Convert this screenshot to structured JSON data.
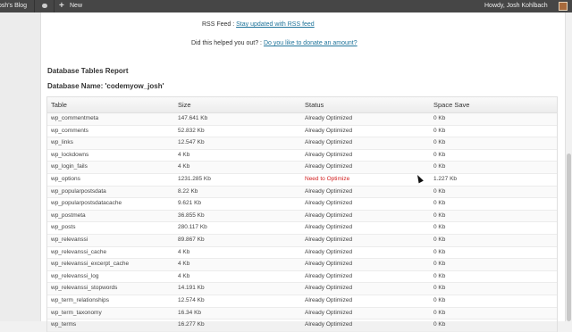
{
  "admin_bar": {
    "site_name": "osh's Blog",
    "new_label": "New",
    "greeting": "Howdy, Josh Kohlbach",
    "icons": [
      "comment-bubble-icon",
      "plus-icon",
      "avatar-icon"
    ]
  },
  "rss": {
    "label": "RSS Feed : ",
    "link": "Stay updated with RSS feed"
  },
  "donate": {
    "label": "Did this helped you out? : ",
    "link": "Do you like to donate an amount?"
  },
  "report": {
    "title": "Database Tables Report",
    "db_name": "Database Name: 'codemyow_josh'"
  },
  "table": {
    "headers": [
      "Table",
      "Size",
      "Status",
      "Space Save"
    ],
    "rows": [
      [
        "wp_commentmeta",
        "147.641 Kb",
        "Already Optimized",
        "0 Kb"
      ],
      [
        "wp_comments",
        "52.832 Kb",
        "Already Optimized",
        "0 Kb"
      ],
      [
        "wp_links",
        "12.547 Kb",
        "Already Optimized",
        "0 Kb"
      ],
      [
        "wp_lockdowns",
        "4 Kb",
        "Already Optimized",
        "0 Kb"
      ],
      [
        "wp_login_fails",
        "4 Kb",
        "Already Optimized",
        "0 Kb"
      ],
      [
        "wp_options",
        "1231.285 Kb",
        "Need to Optimize",
        "1.227 Kb"
      ],
      [
        "wp_popularpostsdata",
        "8.22 Kb",
        "Already Optimized",
        "0 Kb"
      ],
      [
        "wp_popularpostsdatacache",
        "9.621 Kb",
        "Already Optimized",
        "0 Kb"
      ],
      [
        "wp_postmeta",
        "36.855 Kb",
        "Already Optimized",
        "0 Kb"
      ],
      [
        "wp_posts",
        "280.117 Kb",
        "Already Optimized",
        "0 Kb"
      ],
      [
        "wp_relevanssi",
        "89.867 Kb",
        "Already Optimized",
        "0 Kb"
      ],
      [
        "wp_relevanssi_cache",
        "4 Kb",
        "Already Optimized",
        "0 Kb"
      ],
      [
        "wp_relevanssi_excerpt_cache",
        "4 Kb",
        "Already Optimized",
        "0 Kb"
      ],
      [
        "wp_relevanssi_log",
        "4 Kb",
        "Already Optimized",
        "0 Kb"
      ],
      [
        "wp_relevanssi_stopwords",
        "14.191 Kb",
        "Already Optimized",
        "0 Kb"
      ],
      [
        "wp_term_relationships",
        "12.574 Kb",
        "Already Optimized",
        "0 Kb"
      ],
      [
        "wp_term_taxonomy",
        "16.34 Kb",
        "Already Optimized",
        "0 Kb"
      ],
      [
        "wp_terms",
        "16.277 Kb",
        "Already Optimized",
        "0 Kb"
      ]
    ]
  },
  "colors": {
    "admin_bar": "#464646",
    "link": "#21759b",
    "need_optimize": "#d21f1f"
  }
}
